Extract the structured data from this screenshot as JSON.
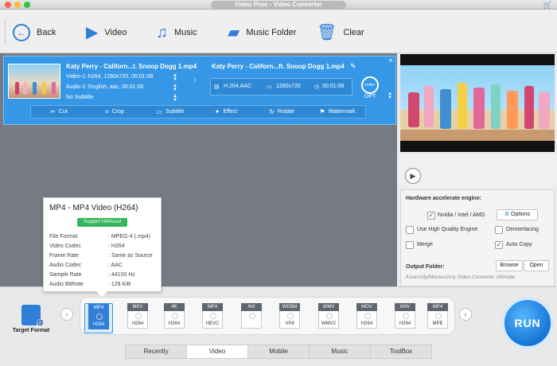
{
  "window": {
    "title": "Video Proc - Video Converter"
  },
  "toolbar": {
    "back": "Back",
    "video": "Video",
    "music": "Music",
    "music_folder": "Music Folder",
    "clear": "Clear"
  },
  "task": {
    "source_name": "Katy Perry - Californ...t. Snoop Dogg 1.mp4",
    "video_track": "Video-1: h264, 1280x720, 00:01:08",
    "audio_track": "Audio-1: English, aac, 00:01:08",
    "subtitle": "No Subtitle",
    "output_name": "Katy Perry - Californ...ft. Snoop Dogg 1.mp4",
    "out_codec": "H.264,AAC",
    "out_resolution": "1280x720",
    "out_duration": "00:01:08",
    "opt_label": "OPT",
    "opt_badge": "codec",
    "edit_tools": [
      "Cut",
      "Crop",
      "Subtitle",
      "Effect",
      "Rotate",
      "Watermark"
    ]
  },
  "settings": {
    "hw_title": "Hardware accelerate engine:",
    "nvidia_label": "Nvidia / Intel / AMD",
    "options_btn": "Options",
    "hq_label": "Use High Quality Engine",
    "deinterlace_label": "Deinterlacing",
    "merge_label": "Merge",
    "autocopy_label": "Auto Copy",
    "output_folder_label": "Output Folder:",
    "output_path": "/Users/dy/Movies/Any Video Converter Ultimate",
    "browse_btn": "Browse",
    "open_btn": "Open"
  },
  "tooltip": {
    "title": "MP4 - MP4 Video (H264)",
    "badge": "Support HWAccel",
    "rows": [
      {
        "k": "File Format",
        "v": ": MPEG-4 (.mp4)"
      },
      {
        "k": "Video Codec",
        "v": ": H264"
      },
      {
        "k": "Frame Rate",
        "v": ": Same as Source"
      },
      {
        "k": "Audio Codec",
        "v": ": AAC"
      },
      {
        "k": "Sample Rate",
        "v": ": 44100 Hz"
      },
      {
        "k": "Audio BitRate",
        "v": ": 128 KiB"
      }
    ]
  },
  "bottom": {
    "target_format": "Target Format",
    "formats": [
      {
        "label": "MP4",
        "codec": "H264"
      },
      {
        "label": "MKV",
        "codec": "H264"
      },
      {
        "label": "4K",
        "codec": "H264"
      },
      {
        "label": "MP4",
        "codec": "HEVC"
      },
      {
        "label": "AVI",
        "codec": ""
      },
      {
        "label": "WEBM",
        "codec": "VP8"
      },
      {
        "label": "WMV",
        "codec": "WMV2"
      },
      {
        "label": "MOV",
        "codec": "H264"
      },
      {
        "label": "M4V",
        "codec": "H264"
      },
      {
        "label": "MP4",
        "codec": "MPE"
      }
    ],
    "tabs": [
      "Recently",
      "Video",
      "Mobile",
      "Music",
      "ToolBox"
    ],
    "run": "RUN"
  }
}
